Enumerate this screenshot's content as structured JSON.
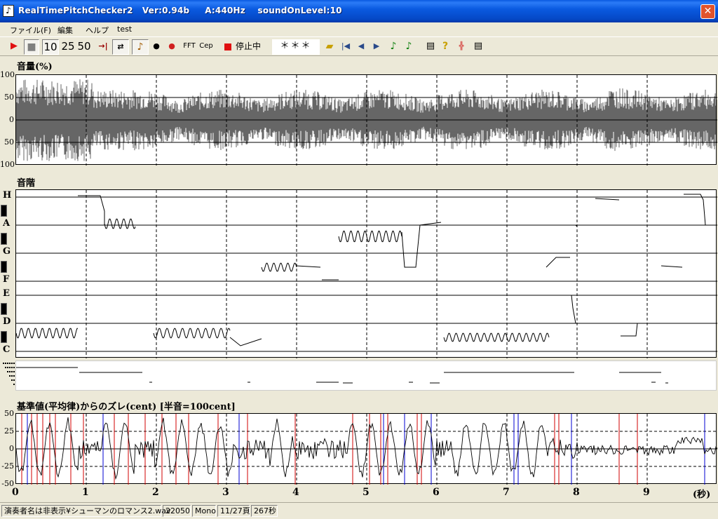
{
  "window": {
    "title": "RealTimePitchChecker2   Ver:0.94b     A:440Hz    soundOnLevel:10",
    "close_glyph": "✕",
    "app_icon": "music-icon"
  },
  "menu": [
    "ファイル(F)",
    "編集",
    "ヘルプ",
    "test"
  ],
  "toolbar": {
    "buttons": [
      {
        "name": "play-button",
        "glyph": "▶",
        "color": "#e01010"
      },
      {
        "name": "stop-button",
        "glyph": "■",
        "color": "#808080"
      },
      {
        "name": "speed-10-button",
        "label": "10"
      },
      {
        "name": "speed-25-button",
        "label": "25"
      },
      {
        "name": "speed-50-button",
        "label": "50"
      },
      {
        "name": "jump-end-button",
        "glyph": "→|"
      },
      {
        "name": "loop-button",
        "glyph": "⇄"
      },
      {
        "name": "violin-button",
        "glyph": "♪"
      },
      {
        "name": "person-button",
        "glyph": "●"
      },
      {
        "name": "person-red-button",
        "glyph": "●"
      },
      {
        "name": "fft-button",
        "label": "FFT"
      },
      {
        "name": "cep-button",
        "label": "Cep"
      }
    ],
    "rec_indicator_color": "#e01010",
    "status_label": "停止中",
    "note_display": "＊＊＊"
  },
  "volume_panel": {
    "label": "音量(%)",
    "yticks": [
      "100",
      "50",
      "0",
      "50",
      "100"
    ]
  },
  "pitch_panel": {
    "label": "音階",
    "notes": [
      "H",
      "A",
      "G",
      "F",
      "E",
      "D",
      "C"
    ]
  },
  "cent_panel": {
    "label": "基準値(平均律)からのズレ(cent) [半音=100cent]",
    "yticks": [
      "50",
      "25",
      "0",
      "-25",
      "-50"
    ]
  },
  "xaxis": {
    "ticks": [
      "0",
      "1",
      "2",
      "3",
      "4",
      "5",
      "6",
      "7",
      "8",
      "9"
    ],
    "unit": "(秒)"
  },
  "statusbar": {
    "file": "演奏者名は非表示¥シューマンのロマンス2.wav",
    "rate": "22050",
    "channels": "Mono",
    "page": "11/27頁",
    "duration": "267秒"
  }
}
